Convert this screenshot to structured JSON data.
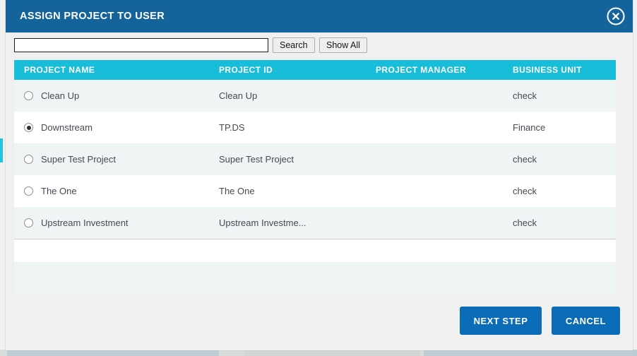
{
  "background": {
    "top_fragment_text": "",
    "accent_color": "#26c1dd"
  },
  "modal": {
    "title": "ASSIGN PROJECT TO USER",
    "header_color": "#15639b",
    "close_icon": "close-circle-icon"
  },
  "toolbar": {
    "search_value": "",
    "search_placeholder": "",
    "search_label": "Search",
    "show_all_label": "Show All"
  },
  "table": {
    "header_color": "#18bdd9",
    "columns": [
      "PROJECT NAME",
      "PROJECT ID",
      "PROJECT MANAGER",
      "BUSINESS UNIT"
    ],
    "rows": [
      {
        "selected": false,
        "name": "Clean Up",
        "id": "Clean Up",
        "manager": "",
        "business_unit": "check"
      },
      {
        "selected": true,
        "name": "Downstream",
        "id": "TP.DS",
        "manager": "",
        "business_unit": "Finance"
      },
      {
        "selected": false,
        "name": "Super Test Project",
        "id": "Super Test Project",
        "manager": "",
        "business_unit": "check"
      },
      {
        "selected": false,
        "name": "The One",
        "id": "The One",
        "manager": "",
        "business_unit": "check"
      },
      {
        "selected": false,
        "name": "Upstream Investment",
        "id": "Upstream Investme...",
        "manager": "",
        "business_unit": "check"
      }
    ]
  },
  "actions": {
    "next_step_label": "NEXT STEP",
    "cancel_label": "CANCEL",
    "button_color": "#0a6cb6"
  }
}
